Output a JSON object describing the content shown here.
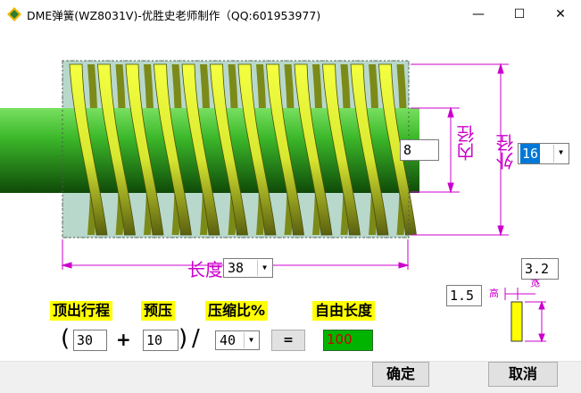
{
  "window": {
    "title": "DME弹簧(WZ8031V)-优胜史老师制作（QQ:601953977)"
  },
  "window_controls": {
    "minimize": "—",
    "maximize": "☐",
    "close": "✕"
  },
  "spring": {
    "inner_diameter_label": "内径",
    "inner_diameter_value": "8",
    "outer_diameter_label": "外径",
    "outer_diameter_value": "16",
    "length_label": "长度",
    "length_value": "38"
  },
  "side": {
    "height_value": "1.5",
    "height_label": "高",
    "width_value": "3.2",
    "width_label": "宽"
  },
  "formula": {
    "travel_label": "顶出行程",
    "preload_label": "预压",
    "compression_label": "压缩比%",
    "free_length_label": "自由长度",
    "open_paren": "(",
    "travel_value": "30",
    "plus": "+",
    "preload_value": "10",
    "close_paren": ")",
    "slash": "/",
    "compression_value": "40",
    "equals_label": "=",
    "free_length_value": "100"
  },
  "buttons": {
    "ok": "确定",
    "cancel": "取消"
  },
  "colors": {
    "coil": "#e0f030",
    "rod": "#2ea81c",
    "guide": "#cc00cc",
    "result_bg": "#00b400",
    "result_text": "#d00000",
    "selection": "#0078d7"
  }
}
